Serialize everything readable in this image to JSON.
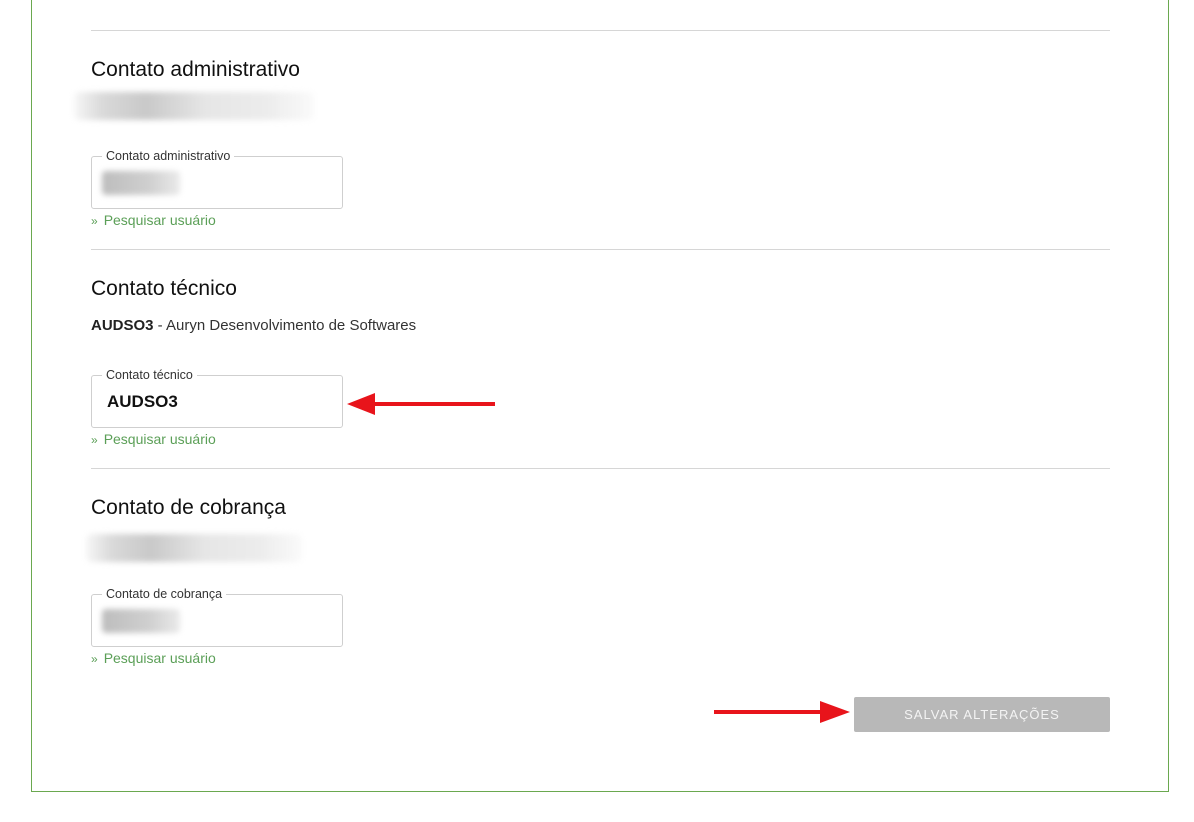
{
  "sections": {
    "admin": {
      "title": "Contato administrativo",
      "field_legend": "Contato administrativo",
      "search_link": "Pesquisar usuário"
    },
    "technical": {
      "title": "Contato técnico",
      "summary_code": "AUDSO3",
      "summary_name": " - Auryn Desenvolvimento de Softwares",
      "field_legend": "Contato técnico",
      "field_value": "AUDSO3",
      "search_link": "Pesquisar usuário"
    },
    "billing": {
      "title": "Contato de cobrança",
      "field_legend": "Contato de cobrança",
      "search_link": "Pesquisar usuário"
    }
  },
  "link_prefix": "»",
  "save_button_label": "SALVAR ALTERAÇÕES",
  "colors": {
    "panel_border": "#6aa84f",
    "link": "#5b9f57",
    "button_disabled": "#b8b8b8",
    "annotation_arrow": "#e8141b"
  }
}
